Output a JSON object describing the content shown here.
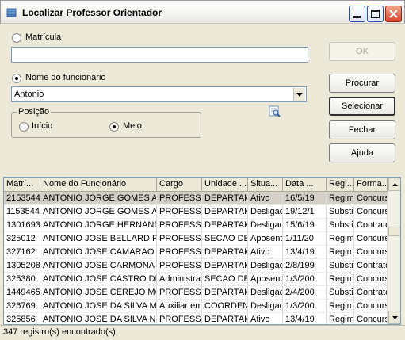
{
  "window": {
    "title": "Localizar Professor Orientador"
  },
  "matricula": {
    "label": "Matrícula",
    "value": ""
  },
  "funcionario": {
    "label": "Nome do funcionário",
    "value": "Antonio"
  },
  "posicao": {
    "legend": "Posição",
    "inicio_label": "Início",
    "meio_label": "Meio",
    "selected": "Meio"
  },
  "buttons": {
    "ok": "OK",
    "procurar": "Procurar",
    "selecionar": "Selecionar",
    "fechar": "Fechar",
    "ajuda": "Ajuda"
  },
  "grid": {
    "columns": [
      "Matrí...",
      "Nome do Funcionário",
      "Cargo",
      "Unidade ...",
      "Situa...",
      "Data ...",
      "Regi...",
      "Forma..."
    ],
    "rows": [
      [
        "2153544",
        "ANTONIO JORGE GOMES AI",
        "PROFESSO",
        "DEPARTAM",
        "Ativo",
        "16/5/19",
        "Regime",
        "Concurso"
      ],
      [
        "1153544",
        "ANTONIO JORGE GOMES AI",
        "PROFESSO",
        "DEPARTAM",
        "Desligac",
        "19/12/1",
        "Substitul",
        "Concurso"
      ],
      [
        "1301693",
        "ANTONIO JORGE HERNAND",
        "PROFESSO",
        "DEPARTAM",
        "Desligac",
        "15/6/19",
        "Substitul",
        "Contrato"
      ],
      [
        "325012",
        "ANTONIO JOSE BELLARD P",
        "PROFESSO",
        "SECAO DE",
        "Aposent",
        "1/11/20",
        "Regime",
        "Concurso"
      ],
      [
        "327162",
        "ANTONIO JOSE CAMARAO E",
        "PROFESSO",
        "DEPARTAM",
        "Ativo",
        "13/4/19",
        "Regime",
        "Concurso"
      ],
      [
        "1305208",
        "ANTONIO JOSE CARMONA (",
        "PROFESSO",
        "DEPARTAM",
        "Desligac",
        "2/8/199",
        "Substitul",
        "Contrato"
      ],
      [
        "325380",
        "ANTONIO JOSE CASTRO DE",
        "Administrad",
        "SECAO DE",
        "Aposent",
        "1/3/200",
        "Regime",
        "Concurso"
      ],
      [
        "1449465",
        "ANTONIO JOSE CEREJO MC",
        "PROFESSO",
        "DEPARTAM",
        "Desligac",
        "2/4/200",
        "Substitul",
        "Contrato"
      ],
      [
        "326769",
        "ANTONIO JOSE DA SILVA M",
        "Auxiliar em",
        "COORDEN",
        "Desligac",
        "1/3/200",
        "Regime",
        "Concurso"
      ],
      [
        "325856",
        "ANTONIO JOSE DA SILVA N",
        "PROFESSO",
        "DEPARTAM",
        "Ativo",
        "13/4/19",
        "Regime",
        "Concurso"
      ]
    ]
  },
  "status": {
    "text": "347 registro(s) encontrado(s)"
  }
}
